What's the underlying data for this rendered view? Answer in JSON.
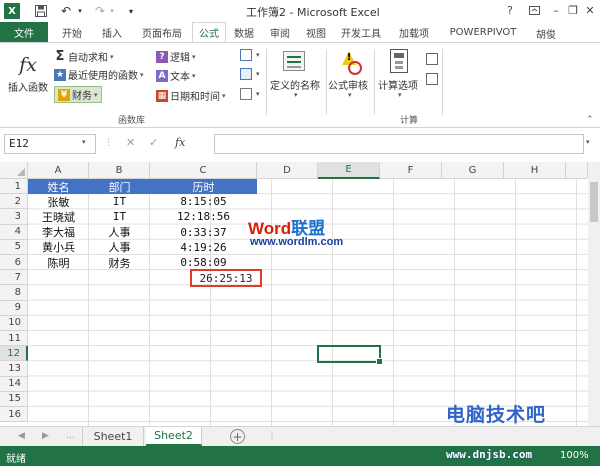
{
  "window": {
    "title": "工作簿2 - Microsoft Excel",
    "user": "胡俊"
  },
  "tabs": [
    "文件",
    "开始",
    "插入",
    "页面布局",
    "公式",
    "数据",
    "审阅",
    "视图",
    "开发工具",
    "加载项",
    "POWERPIVOT"
  ],
  "active_tab": "公式",
  "ribbon": {
    "insert_function": "插入函数",
    "fx_symbol": "fx",
    "autosum": "自动求和",
    "recent": "最近使用的函数",
    "financial": "财务",
    "logical": "逻辑",
    "text": "文本",
    "datetime": "日期和时间",
    "group_library": "函数库",
    "define_name": "定义的名称",
    "formula_auditing": "公式审核",
    "calc_options": "计算选项",
    "group_calc": "计算"
  },
  "formula_bar": {
    "name_box": "E12",
    "formula": "",
    "fx": "fx"
  },
  "columns": [
    "A",
    "B",
    "C",
    "D",
    "E",
    "F",
    "G",
    "H"
  ],
  "rows": [
    "1",
    "2",
    "3",
    "4",
    "5",
    "6",
    "7",
    "8",
    "9",
    "10",
    "11",
    "12",
    "13",
    "14",
    "15",
    "16"
  ],
  "table": {
    "headers": [
      "姓名",
      "部门",
      "历时"
    ],
    "rows": [
      [
        "张敏",
        "IT",
        "8:15:05"
      ],
      [
        "王晓斌",
        "IT",
        "12:18:56"
      ],
      [
        "李大福",
        "人事",
        "0:33:37"
      ],
      [
        "黄小兵",
        "人事",
        "4:19:26"
      ],
      [
        "陈明",
        "财务",
        "0:58:09"
      ]
    ],
    "total": "26:25:13"
  },
  "watermark": {
    "word": "Word",
    "cn": "联盟",
    "url": "www.wordlm.com",
    "brand": "电脑技术吧"
  },
  "sheets": [
    "Sheet1",
    "Sheet2"
  ],
  "active_sheet": "Sheet2",
  "status": {
    "text": "就绪",
    "brand": "www.dnjsb.com",
    "zoom": "100%"
  },
  "colors": {
    "excel_green": "#217346",
    "header_fill": "#4472c4",
    "total_border": "#e03b2b"
  }
}
